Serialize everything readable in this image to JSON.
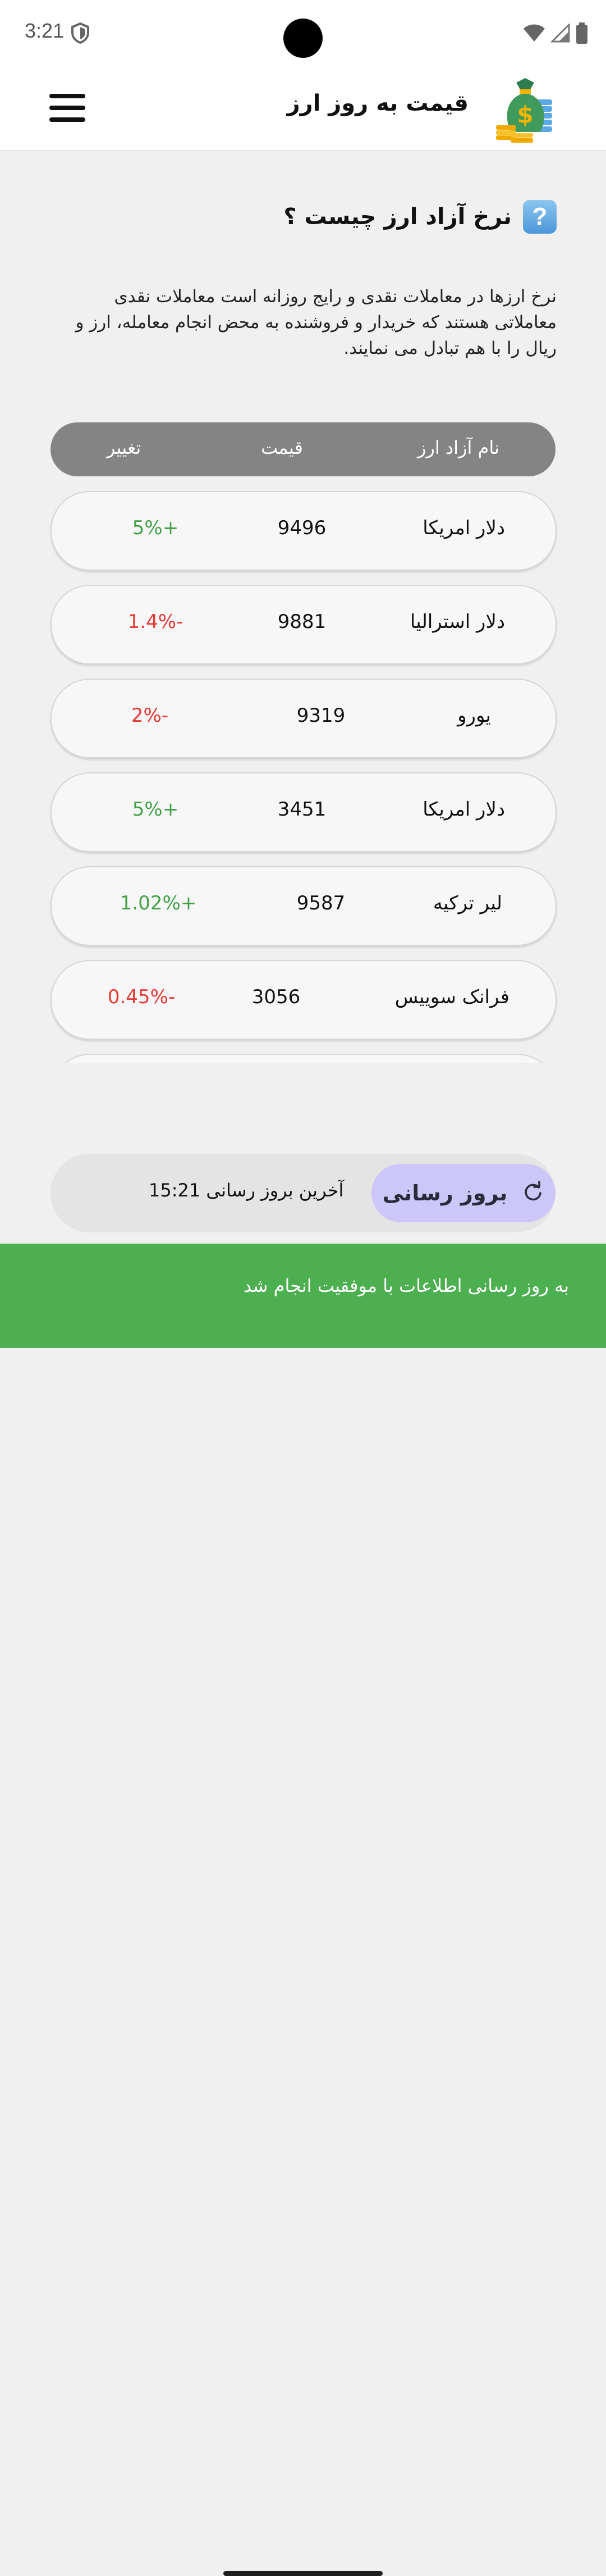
{
  "status_bar": {
    "time": "3:21",
    "icons": [
      "shield-icon",
      "wifi-icon",
      "signal-icon",
      "battery-icon"
    ]
  },
  "app_bar": {
    "title": "قیمت به روز ارز",
    "logo": "money-bag-icon",
    "menu": "hamburger-menu-icon"
  },
  "intro": {
    "question": "نرخ آزاد ارز چیست ؟",
    "description": "نرخ ارزها در معاملات نقدی و رایج روزانه است معاملات نقدی معاملاتی هستند که خریدار و فروشنده به محض انجام معامله، ارز و ریال را با هم تبادل می نمایند."
  },
  "table": {
    "headers": {
      "name": "نام آزاد ارز",
      "price": "قیمت",
      "change": "تغییر"
    },
    "rows": [
      {
        "name": "دلار امریکا",
        "price": "9496",
        "change": "5%+",
        "trend": "up"
      },
      {
        "name": "دلار استرالیا",
        "price": "9881",
        "change": "1.4%-",
        "trend": "down"
      },
      {
        "name": "یورو",
        "price": "9319",
        "change": "2%-",
        "trend": "down"
      },
      {
        "name": "دلار امریکا",
        "price": "3451",
        "change": "5%+",
        "trend": "up"
      },
      {
        "name": "لیر ترکیه",
        "price": "9587",
        "change": "1.02%+",
        "trend": "up"
      },
      {
        "name": "فرانک سوییس",
        "price": "3056",
        "change": "0.45%-",
        "trend": "down"
      },
      {
        "name": "",
        "price": "",
        "change": "",
        "trend": "up"
      }
    ]
  },
  "update": {
    "button_label": "بروز رسانی",
    "last_update_label": "آخرین بروز رسانی",
    "last_update_time": "15:21"
  },
  "snackbar": {
    "message": "به روز رسانی اطلاعات با موفقیت انجام شد"
  },
  "colors": {
    "up": "#43a047",
    "down": "#e53935",
    "header_bg": "#848484",
    "snackbar_bg": "#4caf50",
    "button_bg": "#cdc7f9"
  }
}
